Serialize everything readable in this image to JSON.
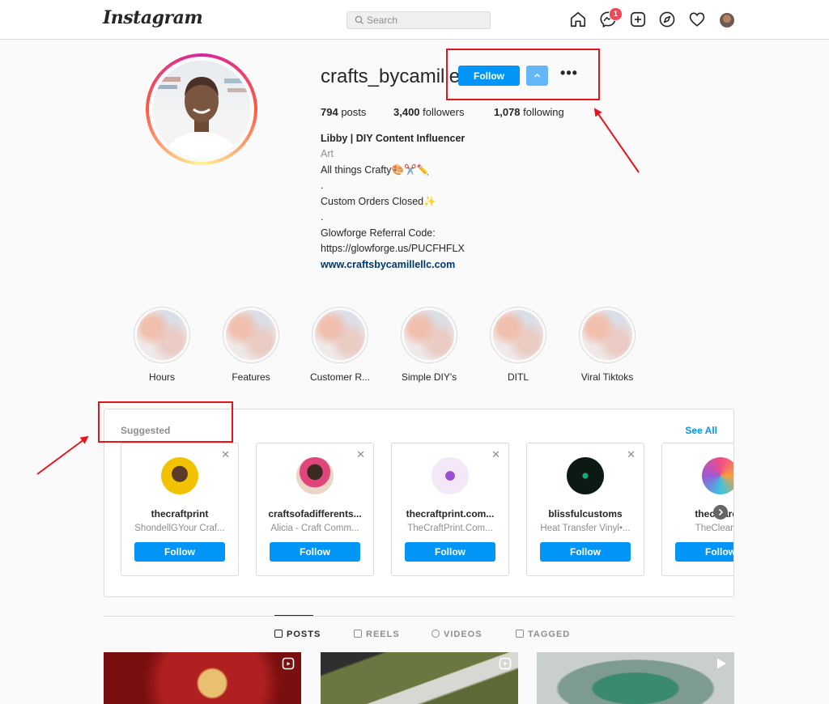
{
  "topbar": {
    "logo": "Instagram",
    "search_placeholder": "Search",
    "messages_badge": "1",
    "icons": [
      "home-icon",
      "messenger-icon",
      "new-post-icon",
      "explore-icon",
      "activity-heart-icon",
      "profile-avatar"
    ]
  },
  "profile": {
    "username": "crafts_bycamille",
    "follow_label": "Follow",
    "more_label": "•••",
    "stats": {
      "posts_count": "794",
      "posts_label": "posts",
      "followers_count": "3,400",
      "followers_label": "followers",
      "following_count": "1,078",
      "following_label": "following"
    },
    "bio": {
      "name": "Libby | DIY Content Influencer",
      "category": "Art",
      "line1": "All things Crafty🎨✂️✏️",
      "dot1": ".",
      "line2": "Custom Orders Closed✨",
      "dot2": ".",
      "line3": "Glowforge Referral Code:",
      "line4": "https://glowforge.us/PUCFHFLX",
      "website": "www.craftsbycamillellc.com"
    }
  },
  "highlights": [
    {
      "label": "Hours"
    },
    {
      "label": "Features"
    },
    {
      "label": "Customer R..."
    },
    {
      "label": "Simple DIY's"
    },
    {
      "label": "DITL"
    },
    {
      "label": "Viral Tiktoks"
    }
  ],
  "suggested": {
    "title": "Suggested",
    "see_all": "See All",
    "dismiss": "✕",
    "cards": [
      {
        "name": "thecraftprint",
        "subtitle": "ShondellGYour Craf...",
        "button": "Follow"
      },
      {
        "name": "craftsofadifferents...",
        "subtitle": "Alicia - Craft Comm...",
        "button": "Follow"
      },
      {
        "name": "thecraftprint.com...",
        "subtitle": "TheCraftPrint.Com...",
        "button": "Follow"
      },
      {
        "name": "blissfulcustoms",
        "subtitle": "Heat Transfer Vinyl•...",
        "button": "Follow"
      },
      {
        "name": "theclearest",
        "subtitle": "TheClearest",
        "button": "Follow"
      }
    ]
  },
  "tabs": [
    {
      "label": "POSTS",
      "active": true
    },
    {
      "label": "REELS",
      "active": false
    },
    {
      "label": "VIDEOS",
      "active": false
    },
    {
      "label": "TAGGED",
      "active": false
    }
  ],
  "colors": {
    "accent": "#0095f6",
    "annotation": "#e8141c",
    "link": "#00376b"
  }
}
